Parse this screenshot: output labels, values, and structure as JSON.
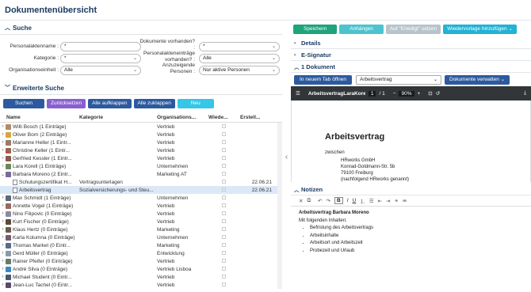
{
  "title": "Dokumentenübersicht",
  "search": {
    "section": "Suche",
    "labels": {
      "akte": "Personalaktenname :",
      "kat": "Kategorie :",
      "org": "Organisationseinheit :",
      "dok": "Dokumente vorhanden? :",
      "pae": "Personalakteneinträge vorhanden? :",
      "anz": "Anzuzeigende Personen :"
    },
    "values": {
      "akte": "*",
      "kat": "*",
      "org": "Alle",
      "dok": "*",
      "pae": "Alle",
      "anz": "Nur aktive Personen"
    }
  },
  "extended": "Erweiterte Suche",
  "buttons": {
    "suchen": "Suchen",
    "reset": "Zurücksetzen",
    "open": "Alle aufklappen",
    "close": "Alle zuklappen",
    "new": "Neu"
  },
  "columns": [
    "Name",
    "Kategorie",
    "Organisations...",
    "Wiede...",
    "Erstell..."
  ],
  "rows": [
    {
      "name": "Willi Bosch (1 Einträge)",
      "org": "Vertrieb",
      "kind": "p",
      "c": "#b08a6a"
    },
    {
      "name": "Oliver Born (2 Einträge)",
      "org": "Vertrieb",
      "kind": "p",
      "c": "#d9a441"
    },
    {
      "name": "Marianne Heller (1 Eintr...",
      "org": "Vertrieb",
      "kind": "p",
      "c": "#9a7a6a"
    },
    {
      "name": "Christine Keller (1 Eintr...",
      "org": "Vertrieb",
      "kind": "p",
      "c": "#a06050"
    },
    {
      "name": "Gerfried Kessler (1 Eintr...",
      "org": "Vertrieb",
      "kind": "p",
      "c": "#8a5a4a"
    },
    {
      "name": "Lara Korell (1 Einträge)",
      "org": "Unternehmen",
      "kind": "p",
      "c": "#6a8a5a"
    },
    {
      "name": "Barbara Moreno (2 Eintr...",
      "org": "Marketing AT",
      "kind": "p",
      "c": "#7a6a9a",
      "open": true
    },
    {
      "name": "Schulungszertifikat H...",
      "cat": "Vertragsunterlagen",
      "date": "22.06.21",
      "kind": "d"
    },
    {
      "name": "Arbeitsvertrag",
      "cat": "Sozialversicherungs- und Steu...",
      "date": "22.06.21",
      "kind": "d",
      "sel": true
    },
    {
      "name": "Max Schmidt (1 Einträge)",
      "org": "Unternehmen",
      "kind": "p",
      "c": "#5a6a7a"
    },
    {
      "name": "Annette Vogel (1 Einträge)",
      "org": "Vertrieb",
      "kind": "p",
      "c": "#9a6a5a"
    },
    {
      "name": "Nino Filipovic (0 Einträge)",
      "org": "Vertrieb",
      "kind": "p",
      "c": "#8a8aa0"
    },
    {
      "name": "Kurt Fischer (0 Einträge)",
      "org": "Vertrieb",
      "kind": "p",
      "c": "#5a4a3a"
    },
    {
      "name": "Klaus Hertz (0 Einträge)",
      "org": "Marketing",
      "kind": "p",
      "c": "#6a5a4a"
    },
    {
      "name": "Karla Kolumna (0 Einträge)",
      "org": "Unternehmen",
      "kind": "p",
      "c": "#7a5a6a"
    },
    {
      "name": "Thomas Market (0 Eintr...",
      "org": "Marketing",
      "kind": "p",
      "c": "#5a6a8a"
    },
    {
      "name": "Gerd Müller (0 Einträge)",
      "org": "Entwicklung",
      "kind": "p",
      "c": "#8a9aaa"
    },
    {
      "name": "Rainer Pfeifer (0 Einträge)",
      "org": "Vertrieb",
      "kind": "p",
      "c": "#6a7a6a"
    },
    {
      "name": "André Silva (0 Einträge)",
      "org": "Vertrieb Lisboa",
      "kind": "p",
      "c": "#3a8ac0"
    },
    {
      "name": "Michael Student (0 Eintr...",
      "org": "Vertrieb",
      "kind": "p",
      "c": "#4a5a6a"
    },
    {
      "name": "Jean-Luc Tachel (0 Eintr...",
      "org": "Vertrieb",
      "kind": "p",
      "c": "#5a4a6a"
    }
  ],
  "right": {
    "btns": {
      "save": "Speichern",
      "attach": "Anhängen",
      "ok": "Auf \"Erledigt\" setzen",
      "tpl": "Wiedervorlage hinzufügen"
    },
    "details": "Details",
    "esig": "E-Signatur",
    "doc1": "1 Dokument",
    "newtab": "In neuem Tab öffnen",
    "docsel": "Arbeitsvertrag",
    "manage": "Dokumente verwalten",
    "pdf": {
      "file": "ArbeitsvertragLaraKore...",
      "page": "1",
      "pages": "/ 1",
      "zoom": "90%",
      "heading": "Arbeitsvertrag",
      "between": "zwischen",
      "lines": [
        "HRworks GmbH",
        "Konrad-Goldmann-Str. 5b",
        "79100 Freiburg",
        "(nachfolgend HRworks genannt)"
      ]
    },
    "notes": "Notizen",
    "note": {
      "title": "Arbeitsvertrag Barbara Moreno",
      "intro": "Mit folgenden Inhalten:",
      "items": [
        "Befristung des Arbeitsvertrags",
        "Arbeitsinhalte",
        "Arbeitsort und Arbeitszeit",
        "Probezeit und Urlaub"
      ]
    }
  }
}
